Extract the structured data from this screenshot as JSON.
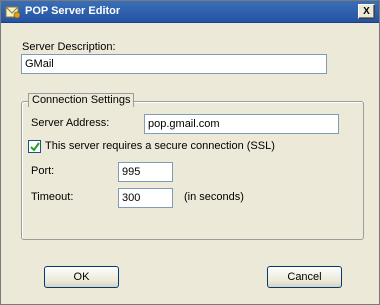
{
  "window": {
    "title": "POP Server Editor",
    "close_label": "X"
  },
  "server_description": {
    "label": "Server Description:",
    "value": "GMail"
  },
  "connection_settings": {
    "legend": "Connection Settings",
    "server_address": {
      "label": "Server Address:",
      "value": "pop.gmail.com"
    },
    "ssl": {
      "label": "This server requires a secure connection (SSL)",
      "checked": true
    },
    "port": {
      "label": "Port:",
      "value": "995"
    },
    "timeout": {
      "label": "Timeout:",
      "value": "300",
      "unit": "(in seconds)"
    }
  },
  "buttons": {
    "ok": "OK",
    "cancel": "Cancel"
  },
  "colors": {
    "titlebar": "#2453a3",
    "dialog_bg": "#ece9d8",
    "check": "#21a121"
  }
}
